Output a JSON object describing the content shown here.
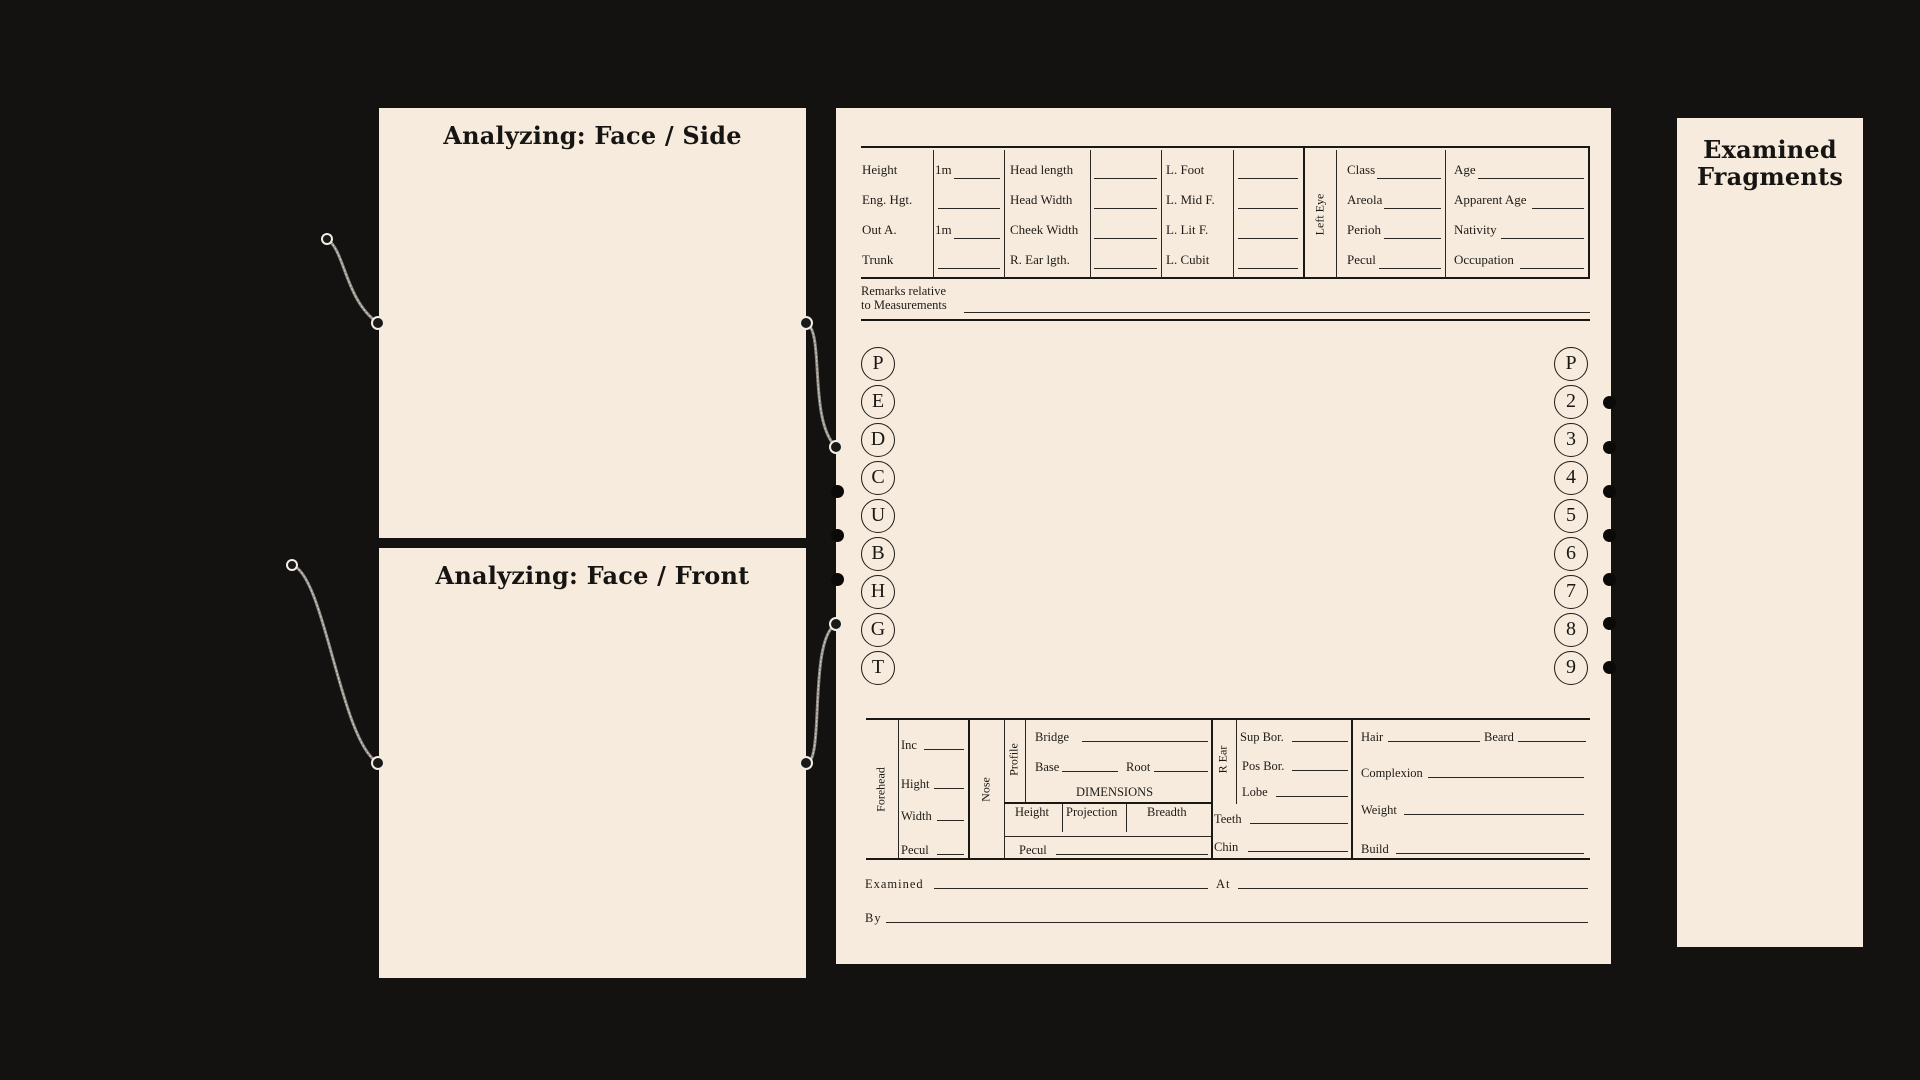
{
  "panels": {
    "side_title": "Analyzing: Face / Side",
    "front_title": "Analyzing: Face / Front",
    "fragments_title_1": "Examined",
    "fragments_title_2": "Fragments"
  },
  "form": {
    "col1": [
      "Height",
      "Eng. Hgt.",
      "Out A.",
      "Trunk"
    ],
    "col1_prefix": "1m",
    "col2": [
      "Head length",
      "Head Width",
      "Cheek Width",
      "R. Ear lgth."
    ],
    "col3": [
      "L. Foot",
      "L. Mid F.",
      "L. Lit F.",
      "L. Cubit"
    ],
    "left_eye": "Left Eye",
    "col4": [
      "Class",
      "Areola",
      "Perioh",
      "Pecul"
    ],
    "col5": [
      "Age",
      "Apparent Age",
      "Nativity",
      "Occupation"
    ],
    "remarks_1": "Remarks relative",
    "remarks_2": "to Measurements",
    "left_circles": [
      "P",
      "E",
      "D",
      "C",
      "U",
      "B",
      "H",
      "G",
      "T"
    ],
    "right_circles": [
      "P",
      "2",
      "3",
      "4",
      "5",
      "6",
      "7",
      "8",
      "9"
    ],
    "forehead": "Forehead",
    "forehead_rows": [
      "Inc",
      "Hight",
      "Width",
      "Pecul"
    ],
    "nose": "Nose",
    "profile": "Profile",
    "bridge": "Bridge",
    "base": "Base",
    "root": "Root",
    "dimensions": "DIMENSIONS",
    "dim_cols": [
      "Height",
      "Projection",
      "Breadth"
    ],
    "nose_pecul": "Pecul",
    "r_ear": "R Ear",
    "ear_rows": [
      "Sup Bor.",
      "Pos Bor.",
      "Lobe"
    ],
    "teeth": "Teeth",
    "chin": "Chin",
    "hair": "Hair",
    "beard": "Beard",
    "complexion": "Complexion",
    "weight": "Weight",
    "build": "Build",
    "examined": "Examined",
    "at": "At",
    "by": "By"
  }
}
